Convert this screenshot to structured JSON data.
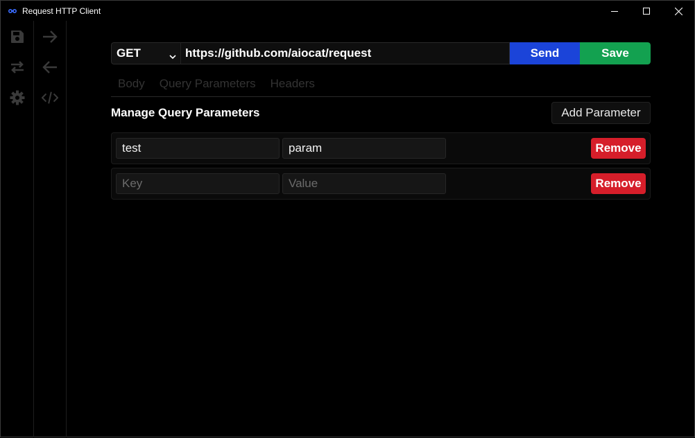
{
  "window": {
    "title": "Request HTTP Client",
    "icons": {
      "app": "link-icon",
      "minimize": "minimize-icon",
      "maximize": "maximize-icon",
      "close": "close-icon"
    }
  },
  "sidebar": {
    "primary": [
      "save-icon",
      "swap-icon",
      "gear-icon"
    ],
    "secondary": [
      "arrow-right-icon",
      "arrow-left-icon",
      "code-icon"
    ]
  },
  "request": {
    "method": "GET",
    "url": "https://github.com/aiocat/request",
    "send_label": "Send",
    "save_label": "Save"
  },
  "tabs": [
    {
      "label": "Body"
    },
    {
      "label": "Query Parameters"
    },
    {
      "label": "Headers"
    }
  ],
  "query_params": {
    "title": "Manage Query Parameters",
    "add_label": "Add Parameter",
    "rows": [
      {
        "key": "test",
        "value": "param",
        "remove_label": "Remove"
      },
      {
        "key": "",
        "value": "",
        "key_placeholder": "Key",
        "value_placeholder": "Value",
        "remove_label": "Remove"
      }
    ]
  },
  "colors": {
    "send": "#1b44d9",
    "save": "#13a150",
    "remove": "#d61e2a",
    "background": "#000000"
  }
}
